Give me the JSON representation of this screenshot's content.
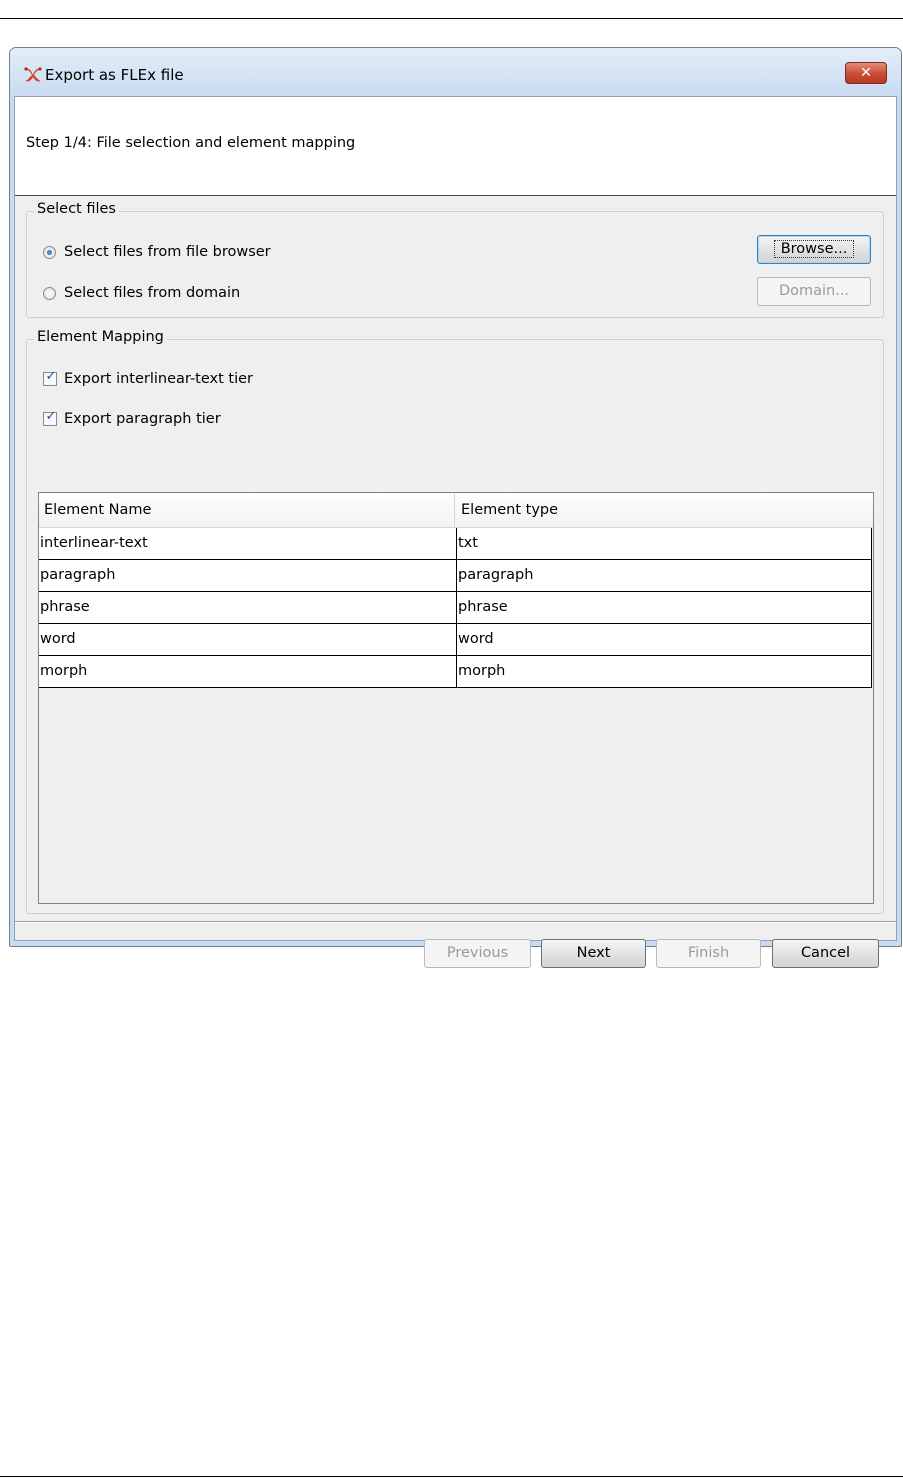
{
  "window": {
    "title": "Export as FLEx file",
    "close_label": "✕"
  },
  "header": {
    "step_text": "Step 1/4: File selection and element mapping"
  },
  "select_files": {
    "legend": "Select files",
    "option_browser": "Select files from file browser",
    "option_domain": "Select files from domain",
    "selected": "browser",
    "browse_label": "Browse...",
    "domain_label": "Domain..."
  },
  "element_mapping": {
    "legend": "Element Mapping",
    "check_interlinear": {
      "label": "Export interlinear-text tier",
      "checked": true
    },
    "check_paragraph": {
      "label": "Export paragraph tier",
      "checked": true
    },
    "table": {
      "columns": [
        "Element Name",
        "Element type"
      ],
      "rows": [
        [
          "interlinear-text",
          "txt"
        ],
        [
          "paragraph",
          "paragraph"
        ],
        [
          "phrase",
          "phrase"
        ],
        [
          "word",
          "word"
        ],
        [
          "morph",
          "morph"
        ]
      ]
    }
  },
  "footer": {
    "previous_label": "Previous",
    "next_label": "Next",
    "finish_label": "Finish",
    "cancel_label": "Cancel"
  },
  "colors": {
    "title_gradient_top": "#e4eefa",
    "close_red": "#c94d35",
    "app_icon": "#d2402c"
  },
  "icons": {
    "app": "flex-app-icon",
    "close": "close-icon",
    "check": "checkmark-icon"
  }
}
